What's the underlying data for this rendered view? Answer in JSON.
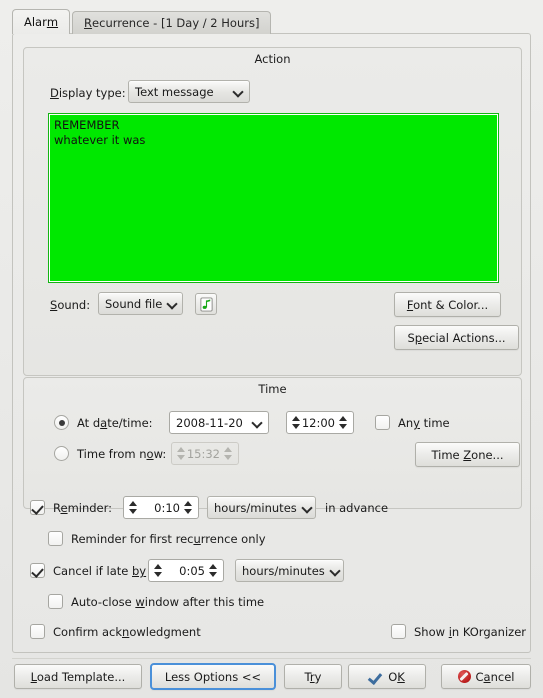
{
  "window": {
    "tabs": [
      {
        "label_pre": "Alar",
        "label_accel": "m",
        "label_post": "",
        "full": "Alarm",
        "active": true
      },
      {
        "label_pre": "",
        "label_accel": "R",
        "label_post": "ecurrence - [1 Day / 2 Hours]",
        "full": "Recurrence - [1 Day / 2 Hours]",
        "active": false
      }
    ]
  },
  "action": {
    "title": "Action",
    "display_type": {
      "label_accel": "D",
      "label_post": "isplay type:",
      "value": "Text message"
    },
    "message": {
      "line1": "REMEMBER",
      "line2": "whatever it was",
      "background_color": "#00e800",
      "text_color": "#111111"
    },
    "sound": {
      "label_accel": "S",
      "label_post": "ound:",
      "value": "Sound file",
      "config_icon": "music-note-file-icon"
    },
    "font_color_button": {
      "accel": "F",
      "post": "ont & Color..."
    },
    "special_actions_button": {
      "pre": "S",
      "accel": "p",
      "post": "ecial Actions..."
    }
  },
  "time": {
    "title": "Time",
    "at_datetime": {
      "label_pre": "At d",
      "label_accel": "a",
      "label_post": "te/time:",
      "selected": true,
      "date_value": "2008-11-20",
      "time_value": "12:00"
    },
    "any_time": {
      "pre": "An",
      "accel": "y",
      "post": " time",
      "checked": false
    },
    "time_from_now": {
      "label_pre": "Time from n",
      "label_accel": "o",
      "label_post": "w:",
      "selected": false,
      "value": "15:32",
      "enabled": false
    },
    "time_zone_button": {
      "pre": "Time ",
      "accel": "Z",
      "post": "one..."
    }
  },
  "options": {
    "reminder": {
      "label_pre": "R",
      "label_accel": "e",
      "label_post": "minder:",
      "checked": true,
      "value": "0:10",
      "unit": "hours/minutes",
      "suffix": "in advance"
    },
    "reminder_first_only": {
      "pre": "Reminder for first rec",
      "accel": "u",
      "post": "rrence only",
      "checked": false
    },
    "cancel_if_late": {
      "label_pre": "Cancel if late ",
      "label_accel": "by",
      "label_post": "",
      "checked": true,
      "value": "0:05",
      "unit": "hours/minutes"
    },
    "auto_close": {
      "pre": "Auto-close ",
      "accel": "w",
      "post": "indow after this time",
      "checked": false
    },
    "confirm_ack": {
      "pre": "Confirm ack",
      "accel": "n",
      "post": "owledgment",
      "checked": false
    },
    "show_in_korganizer": {
      "pre": "Show ",
      "accel": "i",
      "post": "n KOrganizer",
      "checked": false
    }
  },
  "footer": {
    "load_template": {
      "accel": "L",
      "post": "oad Template..."
    },
    "less_options": {
      "label": "Less Options <<",
      "focused": true
    },
    "try": {
      "pre": "T",
      "accel": "r",
      "post": "y"
    },
    "ok": {
      "pre": "O",
      "accel": "K",
      "post": "",
      "icon": "check-icon"
    },
    "cancel": {
      "pre": "C",
      "accel": "a",
      "post": "ncel",
      "icon": "cancel-icon"
    }
  },
  "colors": {
    "accent_focus": "#4a90d9",
    "message_bg": "#00e800",
    "ok_icon": "#3d6d9e",
    "cancel_icon": "#bb1d1d"
  }
}
